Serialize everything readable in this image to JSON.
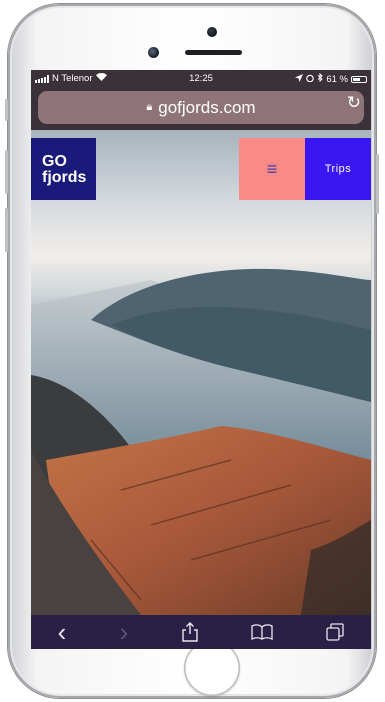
{
  "status_bar": {
    "carrier": "N Telenor",
    "time": "12:25",
    "battery": "61 %",
    "battery_level": 0.61
  },
  "browser": {
    "url": "gofjords.com"
  },
  "site": {
    "logo_line1": "GO",
    "logo_line2": "fjords",
    "menu_icon": "≡",
    "trips_label": "Trips"
  },
  "toolbar": {
    "back": "‹",
    "forward": "›"
  }
}
